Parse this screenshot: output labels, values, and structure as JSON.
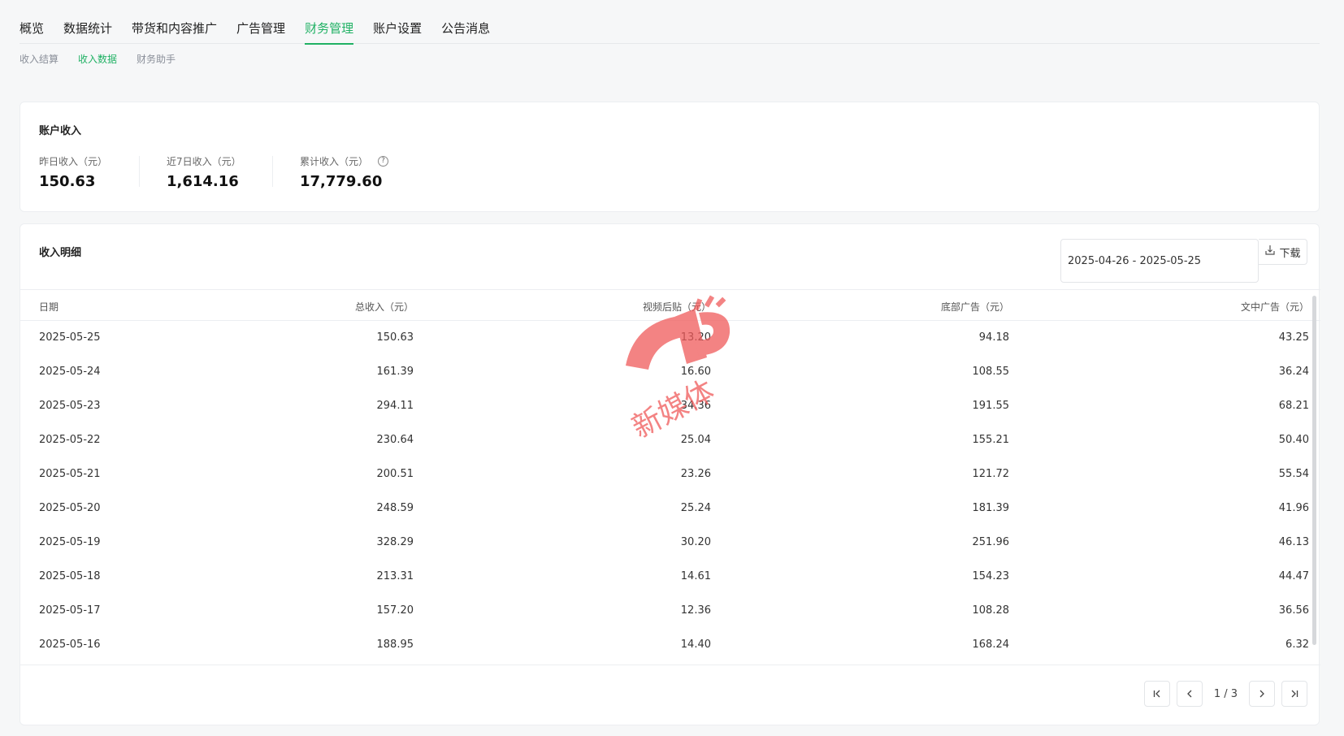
{
  "top_tabs": [
    "概览",
    "数据统计",
    "带货和内容推广",
    "广告管理",
    "财务管理",
    "账户设置",
    "公告消息"
  ],
  "active_tab": 4,
  "sub_tabs": [
    "收入结算",
    "收入数据",
    "财务助手"
  ],
  "active_sub_tab": 1,
  "account_income": {
    "title": "账户收入",
    "stats": [
      {
        "label": "昨日收入（元）",
        "value": "150.63"
      },
      {
        "label": "近7日收入（元）",
        "value": "1,614.16"
      },
      {
        "label": "累计收入（元）",
        "value": "17,779.60"
      }
    ],
    "help_icon": "question-circle-icon"
  },
  "income_detail": {
    "title": "收入明细",
    "date_range": "2025-04-26 - 2025-05-25",
    "download_label": "下载",
    "columns": [
      "日期",
      "总收入（元）",
      "视频后贴（元）",
      "底部广告（元）",
      "文中广告（元）"
    ],
    "rows": [
      [
        "2025-05-25",
        "150.63",
        "13.20",
        "94.18",
        "43.25"
      ],
      [
        "2025-05-24",
        "161.39",
        "16.60",
        "108.55",
        "36.24"
      ],
      [
        "2025-05-23",
        "294.11",
        "34.36",
        "191.55",
        "68.21"
      ],
      [
        "2025-05-22",
        "230.64",
        "25.04",
        "155.21",
        "50.40"
      ],
      [
        "2025-05-21",
        "200.51",
        "23.26",
        "121.72",
        "55.54"
      ],
      [
        "2025-05-20",
        "248.59",
        "25.24",
        "181.39",
        "41.96"
      ],
      [
        "2025-05-19",
        "328.29",
        "30.20",
        "251.96",
        "46.13"
      ],
      [
        "2025-05-18",
        "213.31",
        "14.61",
        "154.23",
        "44.47"
      ],
      [
        "2025-05-17",
        "157.20",
        "12.36",
        "108.28",
        "36.56"
      ],
      [
        "2025-05-16",
        "188.95",
        "14.40",
        "168.24",
        "6.32"
      ]
    ],
    "pager": {
      "info": "1 / 3"
    }
  },
  "watermark": {
    "text": "新媒体",
    "color": "#f05a5a"
  },
  "colors": {
    "accent": "#20b164"
  }
}
